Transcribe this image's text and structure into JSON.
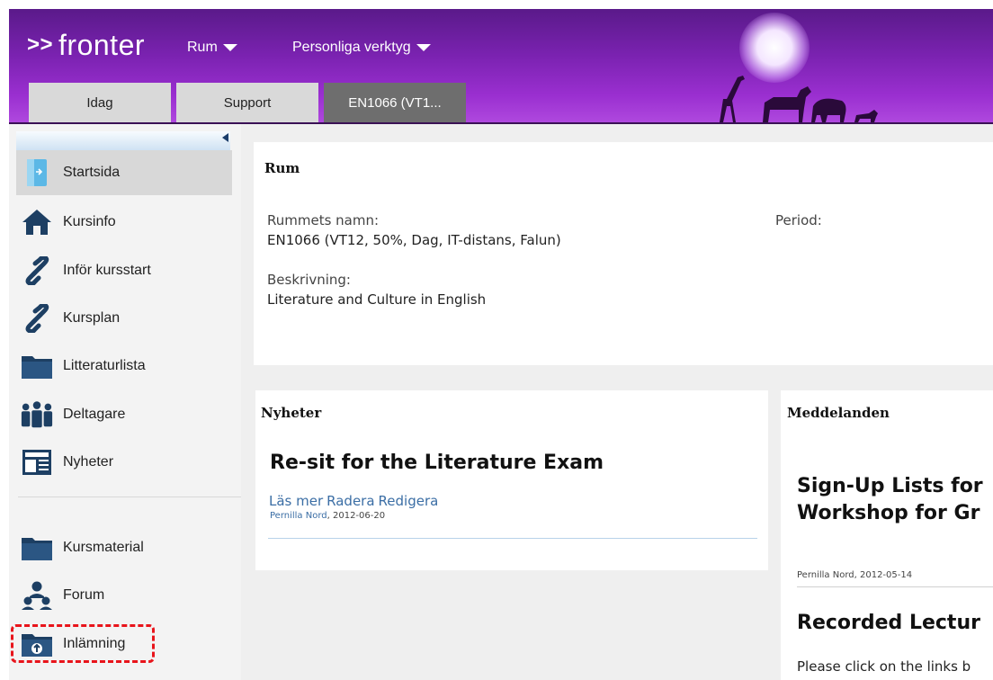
{
  "header": {
    "logo_text": "fronter",
    "logo_prefix": ">>",
    "menus": [
      {
        "label": "Rum"
      },
      {
        "label": "Personliga verktyg"
      }
    ],
    "tabs": [
      {
        "label": "Idag",
        "active": false
      },
      {
        "label": "Support",
        "active": false
      },
      {
        "label": "EN1066 (VT1...",
        "active": true
      }
    ]
  },
  "sidebar": {
    "items": [
      {
        "label": "Startsida",
        "icon": "door-icon",
        "active": true
      },
      {
        "label": "Kursinfo",
        "icon": "home-icon"
      },
      {
        "label": "Inför kursstart",
        "icon": "link-icon"
      },
      {
        "label": "Kursplan",
        "icon": "link-icon"
      },
      {
        "label": "Litteraturlista",
        "icon": "folder-icon"
      },
      {
        "label": "Deltagare",
        "icon": "people-icon"
      },
      {
        "label": "Nyheter",
        "icon": "newspaper-icon"
      },
      {
        "label": "Kursmaterial",
        "icon": "folder-icon"
      },
      {
        "label": "Forum",
        "icon": "forum-icon"
      },
      {
        "label": "Inlämning",
        "icon": "upload-folder-icon",
        "highlighted": true
      }
    ]
  },
  "rum": {
    "title": "Rum",
    "name_label": "Rummets namn:",
    "name_value": "EN1066 (VT12, 50%, Dag, IT-distans, Falun)",
    "period_label": "Period:",
    "desc_label": "Beskrivning:",
    "desc_value": "Literature and Culture in English"
  },
  "nyheter": {
    "title": "Nyheter",
    "item_title": "Re-sit for the Literature Exam",
    "links": [
      "Läs mer",
      "Radera",
      "Redigera"
    ],
    "author": "Pernilla Nord",
    "date": ", 2012-06-20"
  },
  "meddelanden": {
    "title": "Meddelanden",
    "item1_title_line1": "Sign-Up Lists for",
    "item1_title_line2": "Workshop for Gr",
    "item1_meta": "Pernilla Nord,  2012-05-14",
    "item2_title": "Recorded Lectur",
    "item2_text": "Please click on the links b"
  },
  "colors": {
    "header_purple": "#7a22b0",
    "link_blue": "#3b6ea5",
    "highlight_red": "#e8141b"
  }
}
